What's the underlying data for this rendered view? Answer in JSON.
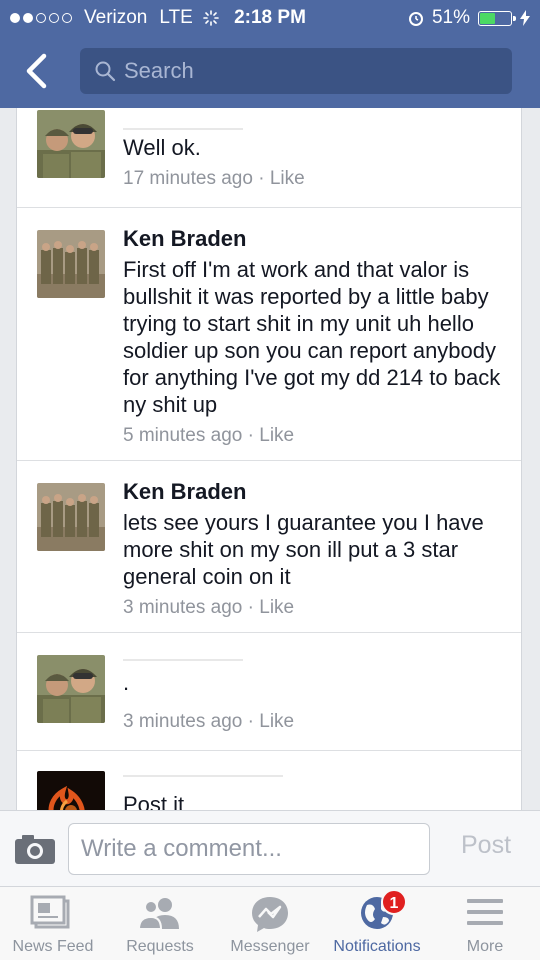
{
  "status_bar": {
    "carrier": "Verizon",
    "network": "LTE",
    "time": "2:18 PM",
    "battery": "51%",
    "battery_level": 0.51
  },
  "nav": {
    "search_placeholder": "Search"
  },
  "comments": [
    {
      "name": "",
      "text": "Well ok.",
      "time": "17 minutes ago",
      "like": "Like",
      "avatar_icon": "profile-photo-two-soldiers-icon"
    },
    {
      "name": "Ken Braden",
      "text": "First off I'm at work and that valor is bullshit it was reported by a little baby trying to start shit in my unit uh hello soldier up son you can report anybody for anything I've got my dd 214 to back ny shit up",
      "time": "5 minutes ago",
      "like": "Like",
      "avatar_icon": "profile-photo-group-soldiers-icon"
    },
    {
      "name": "Ken Braden",
      "text": "lets see yours I guarantee you I have more shit on my son ill put a 3 star general coin on it",
      "time": "3 minutes ago",
      "like": "Like",
      "avatar_icon": "profile-photo-group-soldiers-icon"
    },
    {
      "name": "",
      "text": ".",
      "time": "3 minutes ago",
      "like": "Like",
      "avatar_icon": "profile-photo-two-soldiers-icon"
    },
    {
      "name": "",
      "text": "Post it",
      "avatar_icon": "profile-photo-fire-icon"
    }
  ],
  "composer": {
    "placeholder": "Write a comment...",
    "post_label": "Post"
  },
  "tabs": [
    {
      "label": "News Feed",
      "icon": "news-feed-icon"
    },
    {
      "label": "Requests",
      "icon": "friend-requests-icon"
    },
    {
      "label": "Messenger",
      "icon": "messenger-icon"
    },
    {
      "label": "Notifications",
      "icon": "globe-icon",
      "badge": "1",
      "active": true
    },
    {
      "label": "More",
      "icon": "menu-icon"
    }
  ],
  "colors": {
    "brand": "#4e69a2",
    "badge": "#e02020",
    "battery": "#4cd964"
  }
}
